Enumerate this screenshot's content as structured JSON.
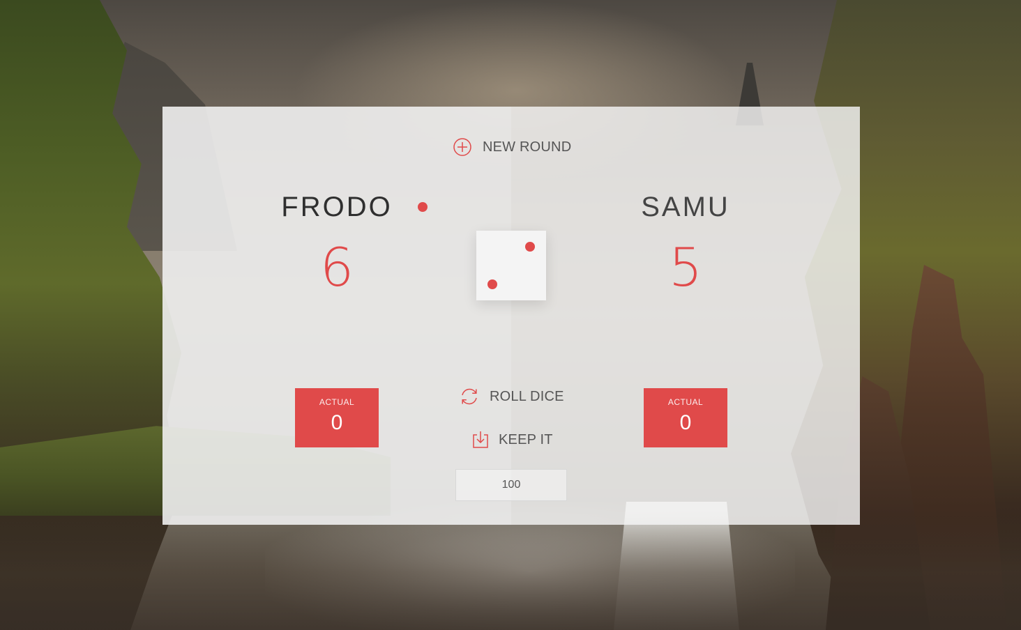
{
  "controls": {
    "new_round_label": "NEW ROUND",
    "roll_dice_label": "ROLL DICE",
    "keep_it_label": "KEEP IT",
    "final_score_value": "100"
  },
  "players": [
    {
      "name": "FRODO",
      "score": "6",
      "current_label": "ACTUAL",
      "current_value": "0",
      "active": true
    },
    {
      "name": "SAMU",
      "score": "5",
      "current_label": "ACTUAL",
      "current_value": "0",
      "active": false
    }
  ],
  "dice": {
    "value": 2
  },
  "colors": {
    "accent": "#e04a4a",
    "panel": "#f0f0f0",
    "text": "#555555"
  },
  "icons": {
    "new_round": "plus-circle-icon",
    "roll_dice": "refresh-icon",
    "keep_it": "download-icon"
  }
}
